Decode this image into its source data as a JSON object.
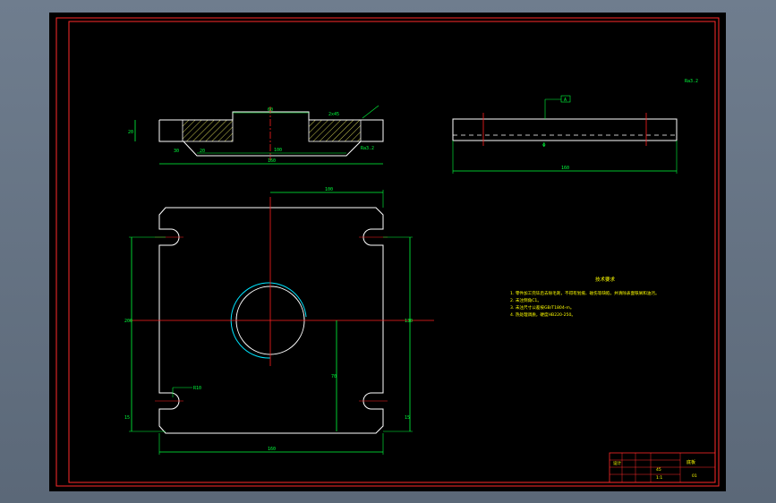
{
  "colors": {
    "background": "#000000",
    "border": "#ff2a2a",
    "outline": "#ffffff",
    "dimension": "#00ff3c",
    "centerline": "#ff2020",
    "hidden_edge": "#ffffff",
    "hatch": "#ffff66",
    "arc_highlight": "#00e5ff",
    "text": "#ffff00"
  },
  "drawing": {
    "section_labels": {
      "top_width": "60",
      "overall_width": "160",
      "bore": "100",
      "left_step": "30",
      "right_step": "20",
      "height": "20",
      "chamfer": "2x45"
    },
    "side_labels": {
      "datum": "A",
      "overall_width": "160",
      "center_mark": "Φ"
    },
    "plan_labels": {
      "width_top": "100",
      "height_total": "200",
      "height_right": "130",
      "height_lower": "70",
      "width_bottom": "160",
      "slot_left": "15",
      "slot_right": "15",
      "slot_tag": "R10"
    },
    "roughness": "Ra3.2"
  },
  "notes": {
    "title": "技术要求",
    "lines": [
      "1. 零件加工完毕后去除毛刺，不得有划痕、碰伤等缺陷，并清除表面铁屑和油污。",
      "2. 未注倒角C1。",
      "3. 未注尺寸公差按GB/T1804-m。",
      "4. 热处理调质，硬度HB220-250。"
    ]
  },
  "title_block": {
    "part_name": "底板",
    "material": "45",
    "scale": "1:1",
    "company": "设计",
    "drawing_no": "01"
  }
}
